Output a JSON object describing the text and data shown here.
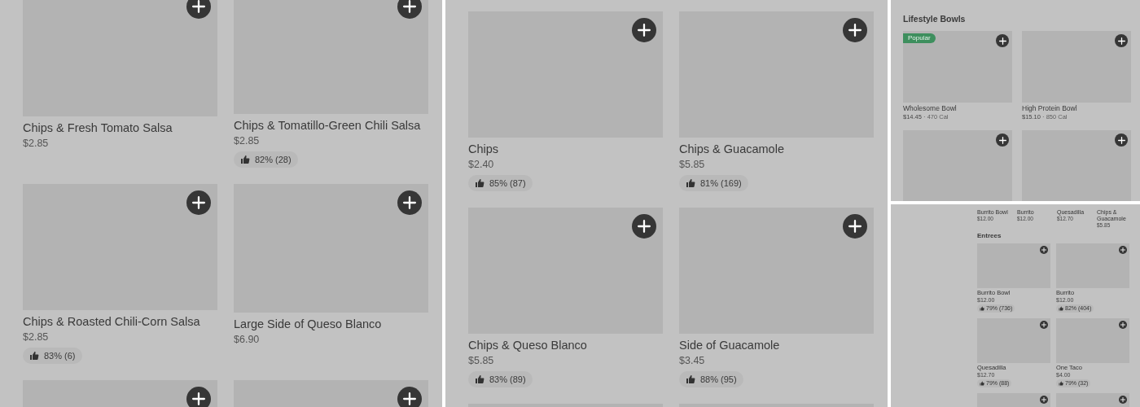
{
  "screens": [
    {
      "kind": "large",
      "items": [
        {
          "kind": "item",
          "name": "Chips & Fresh Tomato Salsa",
          "price": "$2.85"
        },
        {
          "kind": "item",
          "name": "Chips & Tomatillo-Green Chili Salsa",
          "price": "$2.85",
          "rating": "82% (28)"
        },
        {
          "kind": "item",
          "name": "Chips & Roasted Chili-Corn Salsa",
          "price": "$2.85",
          "rating": "83% (6)"
        },
        {
          "kind": "item",
          "name": "Large Side of Queso Blanco",
          "price": "$6.90"
        },
        {
          "kind": "image_only"
        },
        {
          "kind": "image_only"
        }
      ]
    },
    {
      "kind": "large",
      "items": [
        {
          "kind": "item",
          "name": "Chips",
          "price": "$2.40",
          "rating": "85% (87)"
        },
        {
          "kind": "item",
          "name": "Chips & Guacamole",
          "price": "$5.85",
          "rating": "81% (169)"
        },
        {
          "kind": "item",
          "name": "Chips & Queso Blanco",
          "price": "$5.85",
          "rating": "83% (89)"
        },
        {
          "kind": "item",
          "name": "Side of Guacamole",
          "price": "$3.45",
          "rating": "88% (95)"
        },
        {
          "kind": "image_edge"
        },
        {
          "kind": "image_edge"
        }
      ]
    },
    {
      "kind": "small",
      "section_title": "Lifestyle Bowls",
      "items": [
        {
          "kind": "item",
          "name": "Wholesome Bowl",
          "price": "$14.45",
          "separator": "·",
          "calories": "470 Cal",
          "badge": "Popular"
        },
        {
          "kind": "item",
          "name": "High Protein Bowl",
          "price": "$15.10",
          "separator": "·",
          "calories": "850 Cal"
        },
        {
          "kind": "image_only"
        },
        {
          "kind": "image_only"
        }
      ]
    },
    {
      "kind": "tiny",
      "carousel": [
        {
          "name": "Burrito Bowl",
          "price": "$12.00"
        },
        {
          "name": "Burrito",
          "price": "$12.00"
        },
        {
          "name": "Quesadilla",
          "price": "$12.70"
        },
        {
          "name": "Chips & Guacamole",
          "price": "$5.85"
        }
      ],
      "section_title": "Entrees",
      "items": [
        {
          "kind": "item",
          "name": "Burrito Bowl",
          "price": "$12.00",
          "rating": "79% (736)"
        },
        {
          "kind": "item",
          "name": "Burrito",
          "price": "$12.00",
          "rating": "82% (404)"
        },
        {
          "kind": "item",
          "name": "Quesadilla",
          "price": "$12.70",
          "rating": "79% (88)"
        },
        {
          "kind": "item",
          "name": "One Taco",
          "price": "$4.00",
          "rating": "79% (32)"
        },
        {
          "kind": "image_only"
        },
        {
          "kind": "image_only"
        }
      ]
    }
  ]
}
